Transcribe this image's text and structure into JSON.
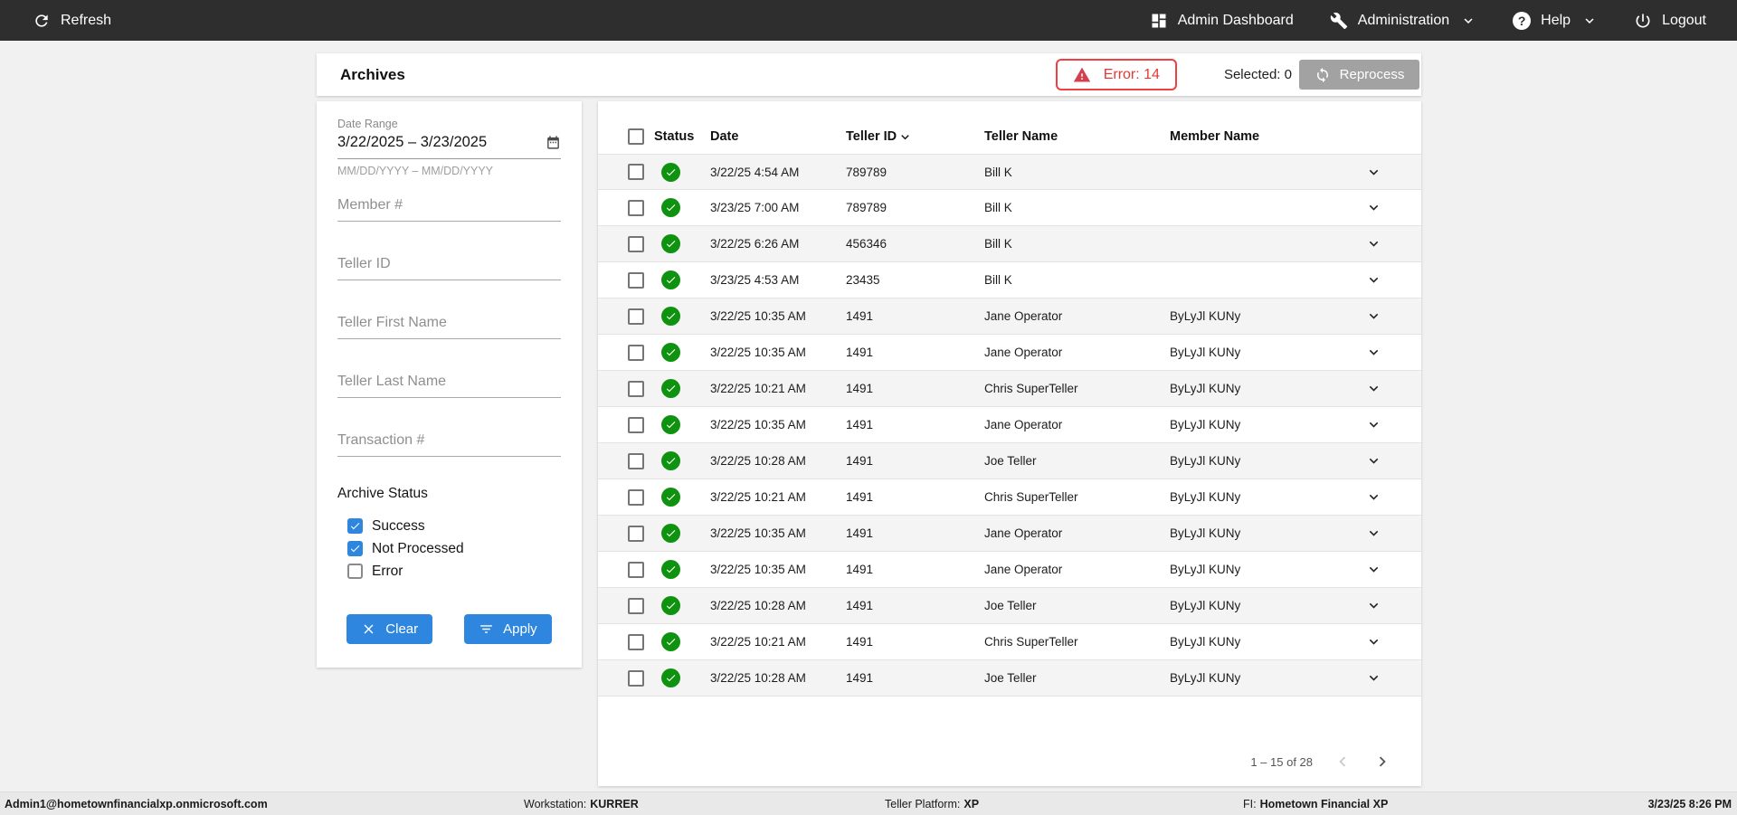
{
  "colors": {
    "topbar_bg": "#2e2e2e",
    "page_bg": "#f1f1f1",
    "accent_blue": "#2e86de",
    "error_red": "#e53935",
    "success_green": "#0f9210",
    "disabled_gray": "#a2a2a2",
    "stripe_gray": "#f4f4f4"
  },
  "topbar": {
    "refresh": "Refresh",
    "admin_dashboard": "Admin Dashboard",
    "administration": "Administration",
    "help": "Help",
    "logout": "Logout"
  },
  "header": {
    "title": "Archives",
    "error_label": "Error: 14",
    "selected_label": "Selected: 0",
    "reprocess_label": "Reprocess"
  },
  "filters": {
    "date_range": {
      "label": "Date Range",
      "value": "3/22/2025 – 3/23/2025",
      "helper": "MM/DD/YYYY – MM/DD/YYYY"
    },
    "member_placeholder": "Member #",
    "teller_id_placeholder": "Teller ID",
    "teller_first_placeholder": "Teller First Name",
    "teller_last_placeholder": "Teller Last Name",
    "transaction_placeholder": "Transaction #",
    "archive_status": {
      "label": "Archive Status",
      "options": [
        {
          "label": "Success",
          "checked": true
        },
        {
          "label": "Not Processed",
          "checked": true
        },
        {
          "label": "Error",
          "checked": false
        }
      ]
    },
    "clear_label": "Clear",
    "apply_label": "Apply"
  },
  "table": {
    "columns": [
      "Status",
      "Date",
      "Teller ID",
      "Teller Name",
      "Member Name"
    ],
    "sorted_column": "Teller ID",
    "rows": [
      {
        "status": "success",
        "date": "3/22/25 4:54 AM",
        "teller_id": "789789",
        "teller_name": "Bill K",
        "member_name": ""
      },
      {
        "status": "success",
        "date": "3/23/25 7:00 AM",
        "teller_id": "789789",
        "teller_name": "Bill K",
        "member_name": ""
      },
      {
        "status": "success",
        "date": "3/22/25 6:26 AM",
        "teller_id": "456346",
        "teller_name": "Bill K",
        "member_name": ""
      },
      {
        "status": "success",
        "date": "3/23/25 4:53 AM",
        "teller_id": "23435",
        "teller_name": "Bill K",
        "member_name": ""
      },
      {
        "status": "success",
        "date": "3/22/25 10:35 AM",
        "teller_id": "1491",
        "teller_name": "Jane Operator",
        "member_name": "ByLyJl KUNy"
      },
      {
        "status": "success",
        "date": "3/22/25 10:35 AM",
        "teller_id": "1491",
        "teller_name": "Jane Operator",
        "member_name": "ByLyJl KUNy"
      },
      {
        "status": "success",
        "date": "3/22/25 10:21 AM",
        "teller_id": "1491",
        "teller_name": "Chris SuperTeller",
        "member_name": "ByLyJl KUNy"
      },
      {
        "status": "success",
        "date": "3/22/25 10:35 AM",
        "teller_id": "1491",
        "teller_name": "Jane Operator",
        "member_name": "ByLyJl KUNy"
      },
      {
        "status": "success",
        "date": "3/22/25 10:28 AM",
        "teller_id": "1491",
        "teller_name": "Joe Teller",
        "member_name": "ByLyJl KUNy"
      },
      {
        "status": "success",
        "date": "3/22/25 10:21 AM",
        "teller_id": "1491",
        "teller_name": "Chris SuperTeller",
        "member_name": "ByLyJl KUNy"
      },
      {
        "status": "success",
        "date": "3/22/25 10:35 AM",
        "teller_id": "1491",
        "teller_name": "Jane Operator",
        "member_name": "ByLyJl KUNy"
      },
      {
        "status": "success",
        "date": "3/22/25 10:35 AM",
        "teller_id": "1491",
        "teller_name": "Jane Operator",
        "member_name": "ByLyJl KUNy"
      },
      {
        "status": "success",
        "date": "3/22/25 10:28 AM",
        "teller_id": "1491",
        "teller_name": "Joe Teller",
        "member_name": "ByLyJl KUNy"
      },
      {
        "status": "success",
        "date": "3/22/25 10:21 AM",
        "teller_id": "1491",
        "teller_name": "Chris SuperTeller",
        "member_name": "ByLyJl KUNy"
      },
      {
        "status": "success",
        "date": "3/22/25 10:28 AM",
        "teller_id": "1491",
        "teller_name": "Joe Teller",
        "member_name": "ByLyJl KUNy"
      }
    ],
    "pagination": {
      "range_label": "1 – 15 of 28"
    }
  },
  "footer": {
    "user": "Admin1@hometownfinancialxp.onmicrosoft.com",
    "workstation_label": "Workstation:",
    "workstation_value": "KURRER",
    "platform_label": "Teller Platform:",
    "platform_value": "XP",
    "fi_label": "FI:",
    "fi_value": "Hometown Financial XP",
    "datetime": "3/23/25 8:26 PM"
  }
}
